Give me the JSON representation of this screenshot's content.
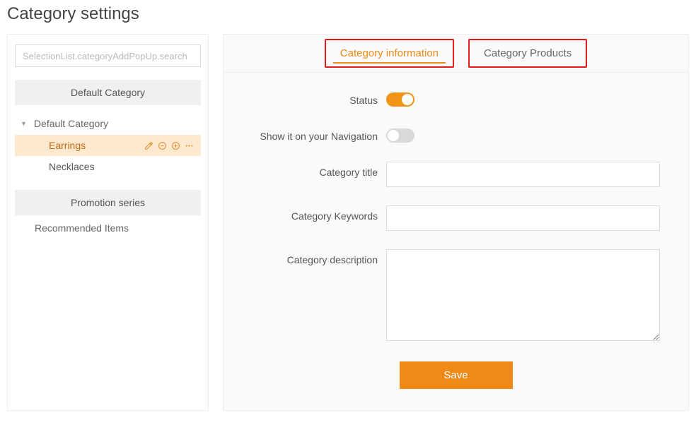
{
  "pageTitle": "Category settings",
  "sidebar": {
    "searchPlaceholder": "SelectionList.categoryAddPopUp.search",
    "sections": {
      "defaultCategoryHeader": "Default Category",
      "promotionHeader": "Promotion series"
    },
    "tree": {
      "rootLabel": "Default Category",
      "items": [
        {
          "label": "Earrings",
          "active": true
        },
        {
          "label": "Necklaces",
          "active": false
        }
      ]
    },
    "recommended": "Recommended Items"
  },
  "tabs": {
    "info": "Category information",
    "products": "Category Products",
    "activeIndex": 0
  },
  "form": {
    "labels": {
      "status": "Status",
      "showNav": "Show it on your Navigation",
      "title": "Category title",
      "keywords": "Category Keywords",
      "description": "Category description"
    },
    "values": {
      "status": true,
      "showNav": false,
      "title": "",
      "keywords": "",
      "description": ""
    },
    "saveLabel": "Save"
  },
  "icons": {
    "edit": "edit-icon",
    "minus": "minus-circle-icon",
    "plus": "plus-circle-icon",
    "more": "more-icon",
    "caret": "caret-down-icon"
  }
}
